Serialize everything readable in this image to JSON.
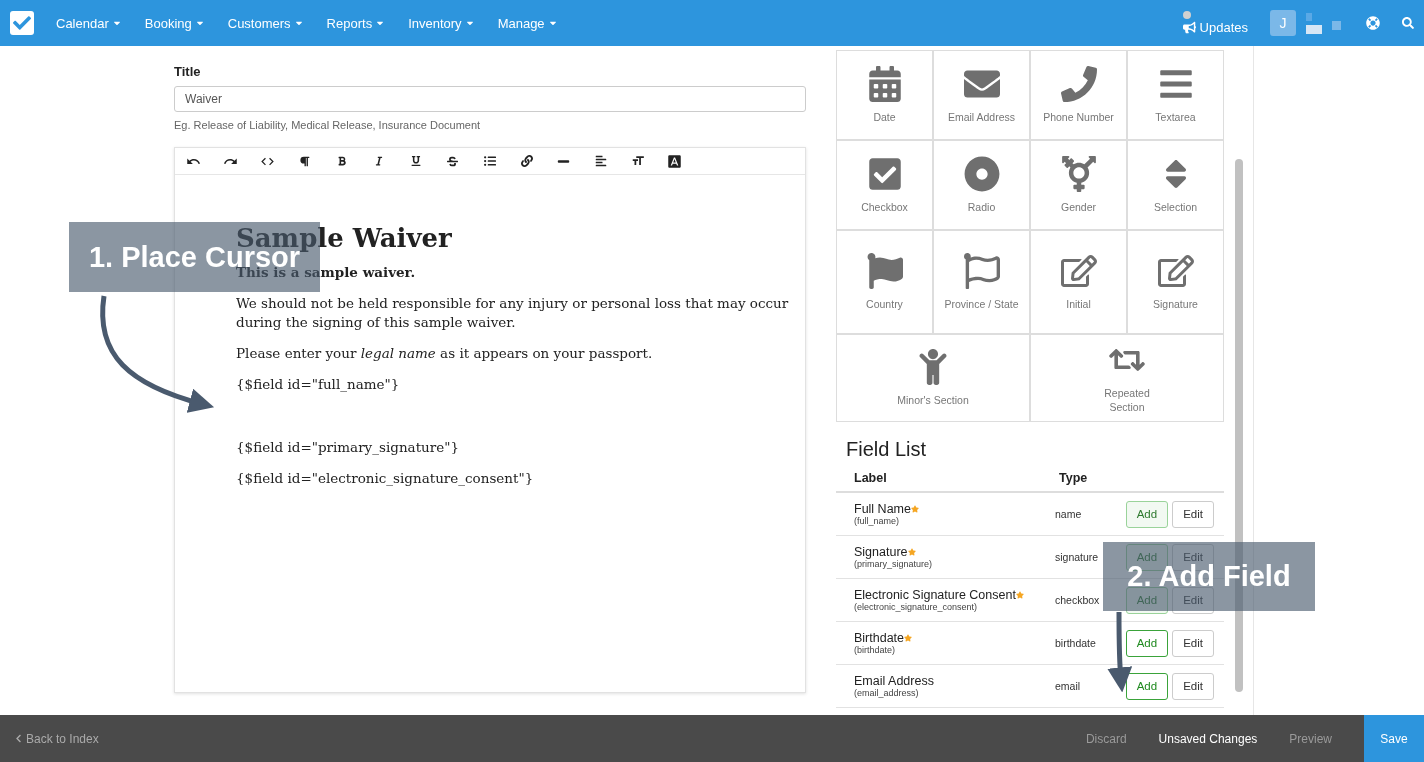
{
  "nav": {
    "items": [
      {
        "label": "Calendar"
      },
      {
        "label": "Booking"
      },
      {
        "label": "Customers"
      },
      {
        "label": "Reports"
      },
      {
        "label": "Inventory"
      },
      {
        "label": "Manage"
      }
    ],
    "updates": "Updates",
    "avatar": "J"
  },
  "title_field": {
    "label": "Title",
    "value": "Waiver",
    "help": "Eg. Release of Liability, Medical Release, Insurance Document"
  },
  "document": [
    {
      "kind": "heading",
      "text": "Sample Waiver"
    },
    {
      "kind": "bold",
      "text": "This is a sample waiver."
    },
    {
      "kind": "text",
      "text": "We should not be held responsible for any injury or personal loss that may occur during the signing of this sample waiver."
    },
    {
      "kind": "text",
      "text": "Please enter your *legal name* as it appears on your passport."
    },
    {
      "kind": "text",
      "text": "{$field id=\"full_name\"}"
    },
    {
      "kind": "gap"
    },
    {
      "kind": "text",
      "text": "{$field id=\"primary_signature\"}"
    },
    {
      "kind": "text",
      "text": "{$field id=\"electronic_signature_consent\"}"
    }
  ],
  "palette": [
    {
      "kind": "date",
      "label": "Date"
    },
    {
      "kind": "email",
      "label": "Email Address"
    },
    {
      "kind": "phone",
      "label": "Phone Number"
    },
    {
      "kind": "textarea",
      "label": "Textarea"
    },
    {
      "kind": "checkbox",
      "label": "Checkbox"
    },
    {
      "kind": "radio",
      "label": "Radio"
    },
    {
      "kind": "gender",
      "label": "Gender"
    },
    {
      "kind": "selection",
      "label": "Selection"
    },
    {
      "kind": "country",
      "label": "Country"
    },
    {
      "kind": "province",
      "label": "Province / State"
    },
    {
      "kind": "initial",
      "label": "Initial"
    },
    {
      "kind": "signature",
      "label": "Signature"
    },
    {
      "kind": "minor",
      "label": "Minor's Section",
      "wide": true
    },
    {
      "kind": "repeated",
      "label": "Repeated Section",
      "wide": true
    }
  ],
  "field_list": {
    "title": "Field List",
    "columns": [
      "Label",
      "Type"
    ],
    "rows": [
      {
        "label": "Full Name",
        "id": "(full_name)",
        "required": true,
        "type": "name",
        "add": "Add",
        "add_disabled": true,
        "edit": "Edit"
      },
      {
        "label": "Signature",
        "id": "(primary_signature)",
        "required": true,
        "type": "signature",
        "add": "Add",
        "add_disabled": true,
        "edit": "Edit"
      },
      {
        "label": "Electronic Signature Consent",
        "id": "(electronic_signature_consent)",
        "required": true,
        "type": "checkbox",
        "add": "Add",
        "add_disabled": true,
        "edit": "Edit"
      },
      {
        "label": "Birthdate",
        "id": "(birthdate)",
        "required": true,
        "type": "birthdate",
        "add": "Add",
        "add_disabled": false,
        "edit": "Edit"
      },
      {
        "label": "Email Address",
        "id": "(email_address)",
        "required": false,
        "type": "email",
        "add": "Add",
        "add_disabled": false,
        "edit": "Edit"
      }
    ]
  },
  "callouts": [
    {
      "text": "1. Place Cursor"
    },
    {
      "text": "2. Add Field"
    }
  ],
  "bottom_bar": {
    "back": "Back to Index",
    "actions": [
      {
        "kind": "muted",
        "label": "Discard"
      },
      {
        "kind": "status",
        "label": "Unsaved Changes"
      },
      {
        "kind": "muted",
        "label": "Preview"
      },
      {
        "kind": "primary",
        "label": "Save"
      }
    ]
  }
}
